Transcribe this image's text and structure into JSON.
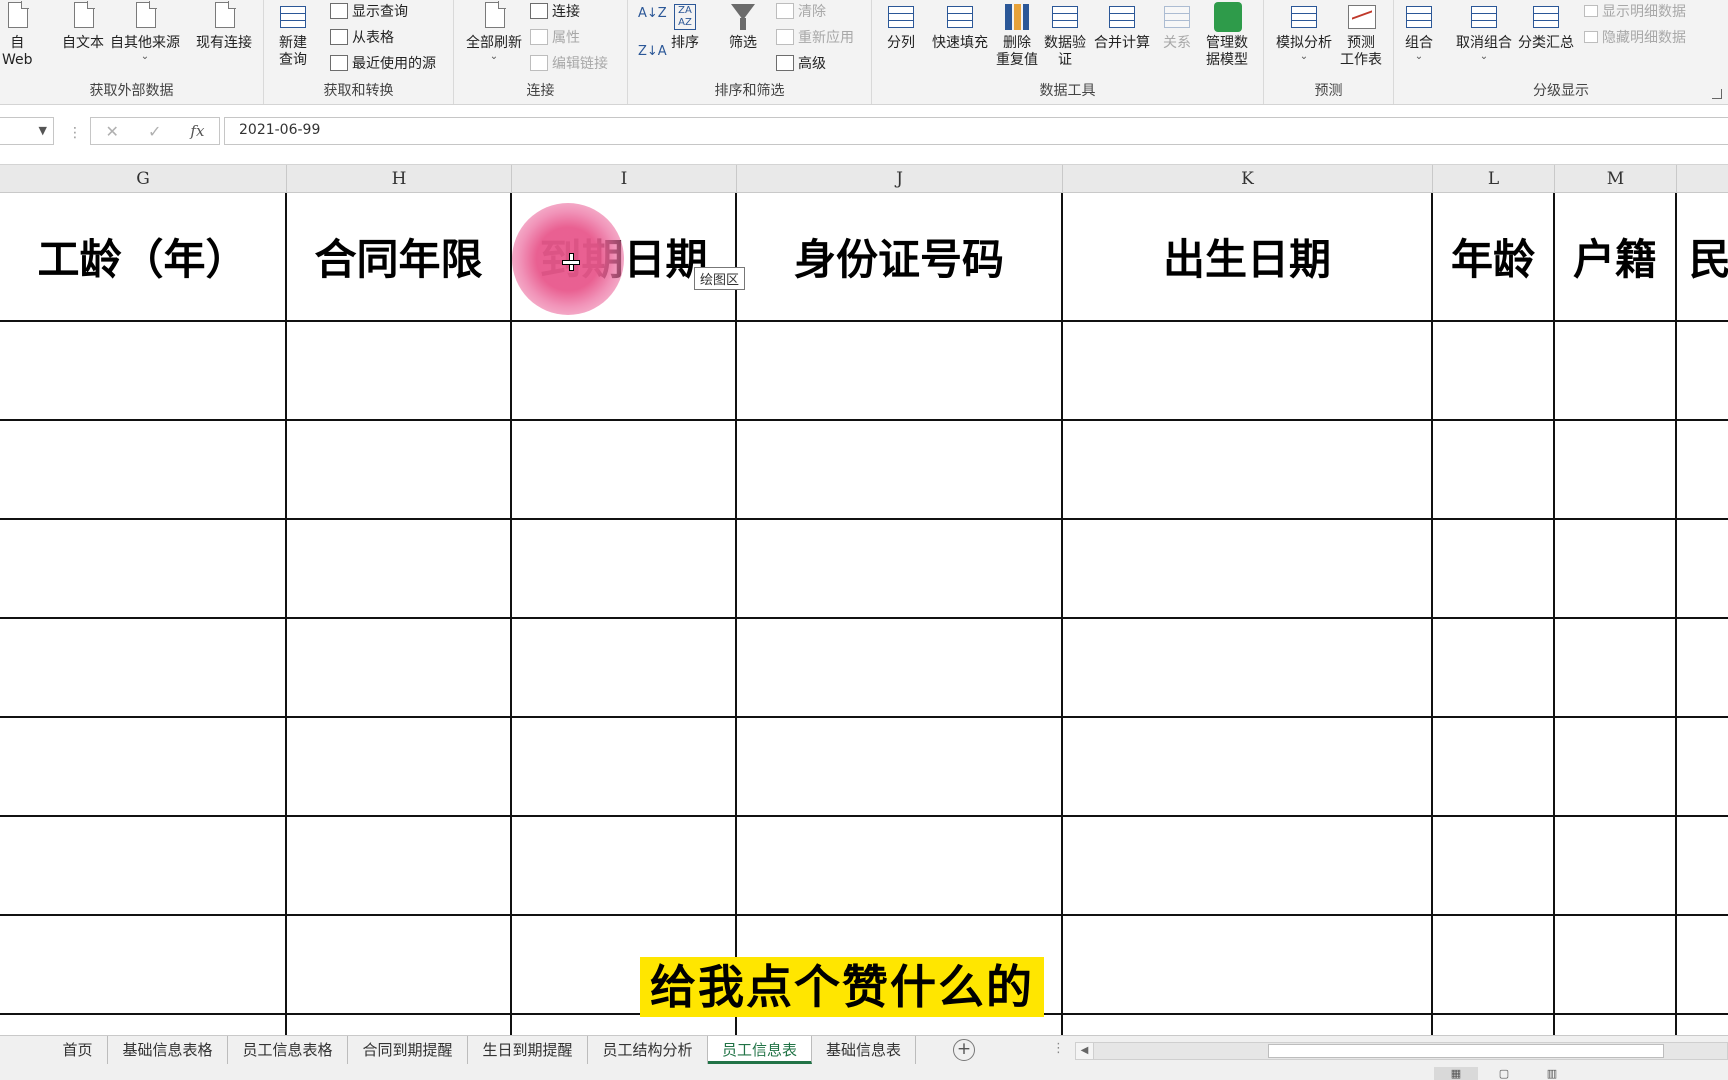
{
  "ribbon": {
    "groups": {
      "external": {
        "label": "获取外部数据",
        "buttons": {
          "web_line1": "自",
          "web_line2": "Web",
          "text": "自文本",
          "other": "自其他来源",
          "existing": "现有连接"
        }
      },
      "transform": {
        "label": "获取和转换",
        "new_query_line1": "新建",
        "new_query_line2": "查询",
        "show_queries": "显示查询",
        "from_table": "从表格",
        "recent_sources": "最近使用的源"
      },
      "connections": {
        "label": "连接",
        "refresh_all": "全部刷新",
        "connections": "连接",
        "properties": "属性",
        "edit_links": "编辑链接"
      },
      "sortfilter": {
        "label": "排序和筛选",
        "sort": "排序",
        "filter": "筛选",
        "clear": "清除",
        "reapply": "重新应用",
        "advanced": "高级"
      },
      "datatools": {
        "label": "数据工具",
        "text_to_columns": "分列",
        "flash_fill": "快速填充",
        "remove_dup_line1": "删除",
        "remove_dup_line2": "重复值",
        "validation_line1": "数据验",
        "validation_line2": "证",
        "consolidate": "合并计算",
        "relationships": "关系",
        "data_model_line1": "管理数",
        "data_model_line2": "据模型"
      },
      "forecast": {
        "label": "预测",
        "what_if": "模拟分析",
        "forecast_line1": "预测",
        "forecast_line2": "工作表"
      },
      "outline": {
        "label": "分级显示",
        "group": "组合",
        "ungroup": "取消组合",
        "subtotal": "分类汇总",
        "show_detail": "显示明细数据",
        "hide_detail": "隐藏明细数据"
      }
    }
  },
  "formula_bar": {
    "fx": "fx",
    "cancel": "✕",
    "enter": "✓",
    "value": "2021-06-99"
  },
  "columns": [
    "G",
    "H",
    "I",
    "J",
    "K",
    "L",
    "M"
  ],
  "headers": [
    "工龄（年）",
    "合同年限",
    "到期日期",
    "身份证号码",
    "出生日期",
    "年龄",
    "户籍",
    "民"
  ],
  "tooltip": "绘图区",
  "subtitle": "给我点个赞什么的",
  "sheet_tabs": [
    "首页",
    "基础信息表格",
    "员工信息表格",
    "合同到期提醒",
    "生日到期提醒",
    "员工结构分析",
    "员工信息表",
    "基础信息表"
  ],
  "active_tab": "员工信息表",
  "add_sheet": "+",
  "colors": {
    "accent": "#217346",
    "highlight": "#ffe600",
    "pink": "#e8588c"
  }
}
